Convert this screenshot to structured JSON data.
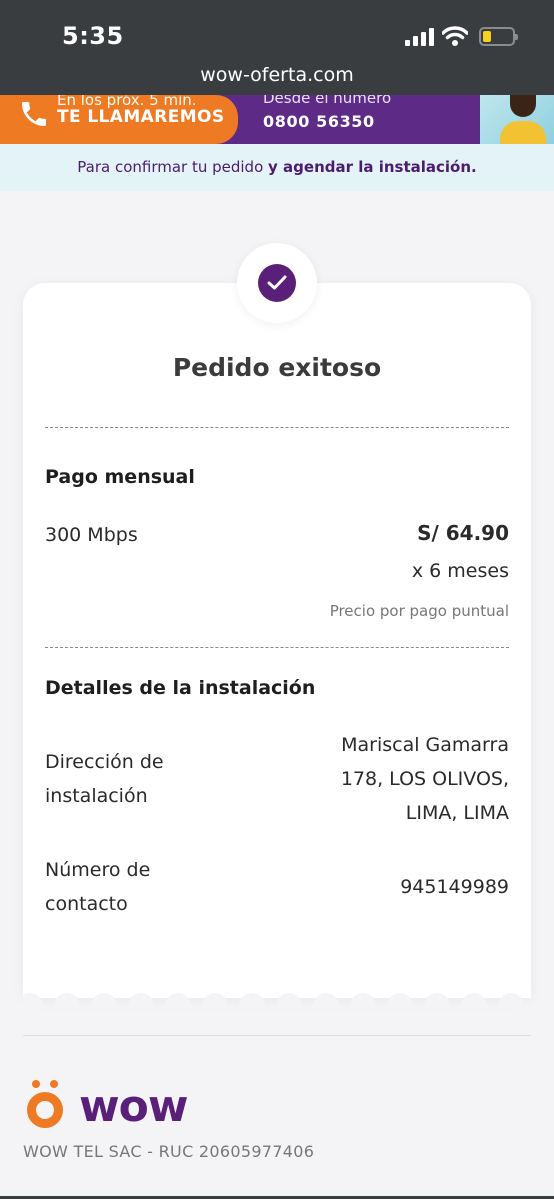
{
  "status_bar": {
    "time": "5:35",
    "url": "wow-oferta.com"
  },
  "banner": {
    "call_line1": "En los próx. 5 min.",
    "call_line2": "TE LLAMAREMOS",
    "from_line": "Desde el número",
    "phone_number": "0800 56350"
  },
  "info_strip": {
    "text_normal": "Para confirmar tu pedido ",
    "text_bold": "y agendar la instalación."
  },
  "order": {
    "title": "Pedido exitoso",
    "monthly_section": "Pago mensual",
    "plan": "300 Mbps",
    "price": "S/ 64.90",
    "duration": "x 6 meses",
    "price_note": "Precio por pago puntual",
    "install_section": "Detalles de la instalación",
    "address_label_1": "Dirección de",
    "address_label_2": "instalación",
    "address_1": "Mariscal Gamarra",
    "address_2": "178, LOS OLIVOS,",
    "address_3": "LIMA, LIMA",
    "contact_label_1": "Número de",
    "contact_label_2": "contacto",
    "contact_number": "945149989"
  },
  "footer": {
    "logo_text": "wow",
    "legal": "WOW TEL SAC - RUC 20605977406"
  },
  "colors": {
    "brand_purple": "#5a1f79",
    "brand_orange": "#ef7a24"
  },
  "icons": [
    "phone-icon",
    "checkmark-icon",
    "wifi-icon",
    "battery-icon",
    "signal-icon"
  ]
}
